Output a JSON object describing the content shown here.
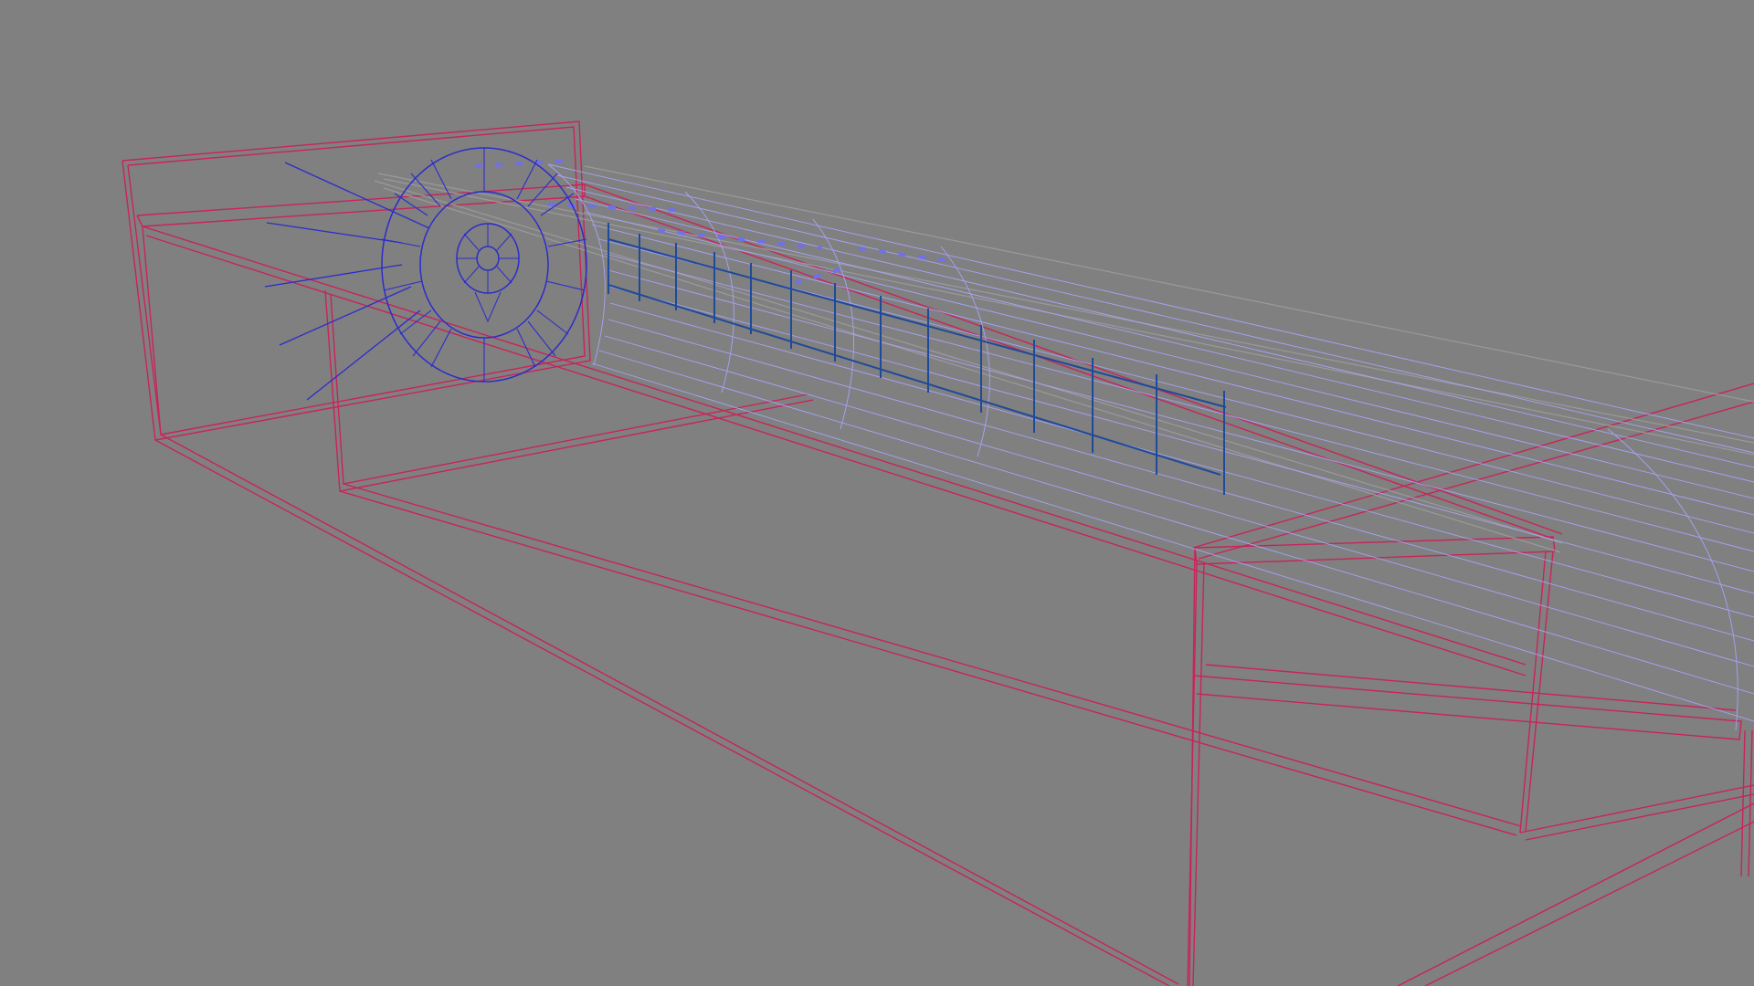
{
  "viewport": {
    "view_mode": "wireframe",
    "background": "#808080"
  },
  "objects": [
    {
      "name": "box-frame",
      "color": "#c8245a"
    },
    {
      "name": "cylinder-tube",
      "color": "#a6a6ff"
    },
    {
      "name": "end-gear",
      "color": "#2c2ccc"
    },
    {
      "name": "ladder-frame",
      "color": "#1f4a99"
    },
    {
      "name": "rail",
      "color": "#9a9a9a"
    }
  ]
}
